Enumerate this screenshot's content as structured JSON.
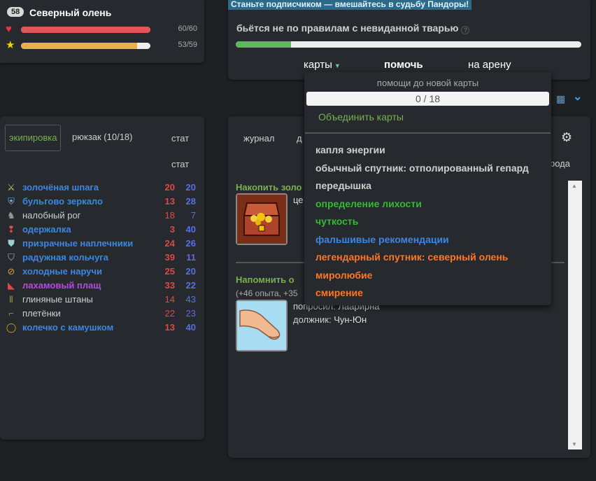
{
  "hero": {
    "level": "58",
    "name": "Северный олень",
    "health": {
      "icon": "heart-icon",
      "text": "60/60",
      "fraction": 1.0,
      "color": "#e05555"
    },
    "gold": {
      "icon": "star-icon",
      "text": "53/59",
      "fraction": 0.898,
      "color": "#f0ad4e"
    }
  },
  "action": {
    "promo": "Станьте подписчиком — вмешайтесь в судьбу Пандоры!",
    "status_text": "бьётся не по правилам с невиданной тварью",
    "progress_fraction": 0.16,
    "tabs": {
      "cards": "карты",
      "help": "помочь",
      "arena": "на арену"
    }
  },
  "cards_dropdown": {
    "caption": "помощи до новой карты",
    "counter": "0 / 18",
    "merge_label": "Объединить карты",
    "items": [
      {
        "label": "капля энергии",
        "color": "#cfcfcf"
      },
      {
        "label": "обычный спутник: отполированный гепард",
        "color": "#cfcfcf"
      },
      {
        "label": "передышка",
        "color": "#cfcfcf"
      },
      {
        "label": "определение лихости",
        "color": "#33bb33"
      },
      {
        "label": "чуткость",
        "color": "#33bb33"
      },
      {
        "label": "фальшивые рекомендации",
        "color": "#3b87e8"
      },
      {
        "label": "легендарный спутник: северный олень",
        "color": "#ff7722"
      },
      {
        "label": "миролюбие",
        "color": "#ff7722"
      },
      {
        "label": "смирение",
        "color": "#ff7722"
      }
    ]
  },
  "inventory": {
    "tabs": {
      "equipment": "экипировка",
      "backpack": "рюкзак (10/18)"
    },
    "stat_header": "стат",
    "stat_header2": "стат",
    "items": [
      {
        "icon": "sword-icon",
        "name": "золочёная шпага",
        "color": "#3b87e8",
        "s1": "20",
        "s2": "20",
        "bold": true
      },
      {
        "icon": "shield-icon",
        "name": "бульгово зеркало",
        "color": "#3b87e8",
        "s1": "13",
        "s2": "28",
        "bold": true
      },
      {
        "icon": "horn-icon",
        "name": "налобный рог",
        "color": "#cfcfcf",
        "s1": "18",
        "s2": "7",
        "bold": false
      },
      {
        "icon": "amulet-icon",
        "name": "одержалка",
        "color": "#3b87e8",
        "s1": "3",
        "s2": "40",
        "bold": true
      },
      {
        "icon": "pauldron-icon",
        "name": "призрачные наплечники",
        "color": "#3b87e8",
        "s1": "24",
        "s2": "26",
        "bold": true
      },
      {
        "icon": "armor-icon",
        "name": "радужная кольчуга",
        "color": "#3b87e8",
        "s1": "39",
        "s2": "11",
        "bold": true
      },
      {
        "icon": "bracer-icon",
        "name": "холодные наручи",
        "color": "#3b87e8",
        "s1": "25",
        "s2": "20",
        "bold": true
      },
      {
        "icon": "cloak-icon",
        "name": "лахамовый плащ",
        "color": "#b44be8",
        "s1": "33",
        "s2": "22",
        "bold": true
      },
      {
        "icon": "pants-icon",
        "name": "глиняные штаны",
        "color": "#cfcfcf",
        "s1": "14",
        "s2": "43",
        "bold": false
      },
      {
        "icon": "boots-icon",
        "name": "плетёнки",
        "color": "#cfcfcf",
        "s1": "22",
        "s2": "23",
        "bold": false
      },
      {
        "icon": "ring-icon",
        "name": "колечко с камушком",
        "color": "#3b87e8",
        "s1": "13",
        "s2": "40",
        "bold": true
      }
    ]
  },
  "journal": {
    "tab_journal": "журнал",
    "tab_partial": "д",
    "right_partial": "рода",
    "task1": {
      "title": "Накопить золо",
      "side_partial": "це"
    },
    "task2": {
      "title": "Напомнить о",
      "note": "(+46 опыта, +35",
      "requested_label": "попросил:",
      "requested_value": "Лаарирна",
      "debtor_label": "должник:",
      "debtor_value": "Чун-Юн"
    }
  },
  "colors": {
    "stat_red": "#e04848",
    "stat_blue": "#5a6ee8",
    "accent_green": "#7bb04f",
    "link_blue": "#4aa0e6"
  }
}
